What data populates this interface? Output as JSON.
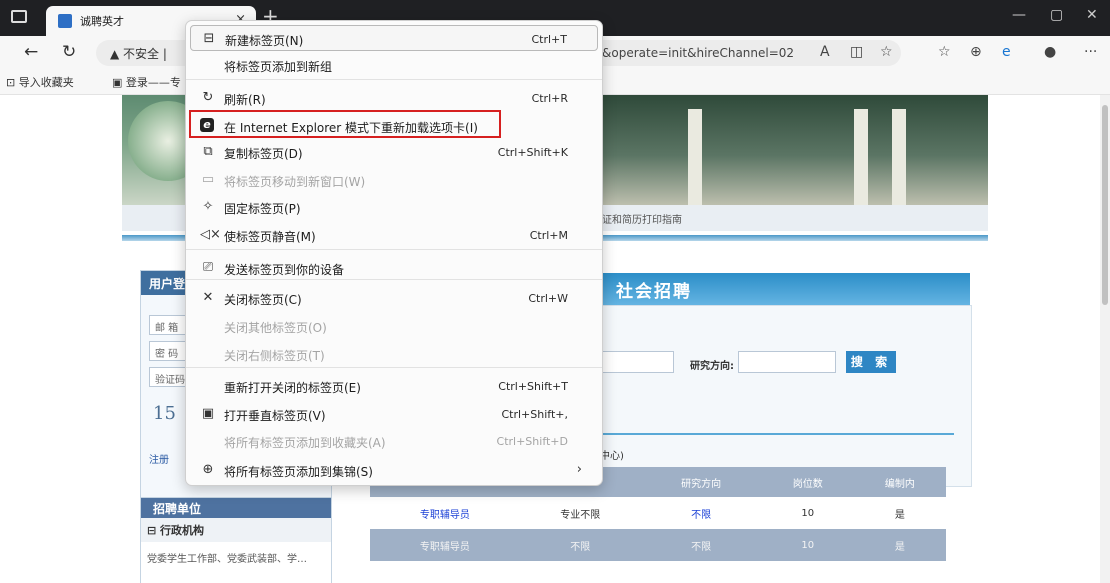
{
  "browser": {
    "tab_title": "诚聘英才",
    "tab_close": "×",
    "new_tab": "+",
    "url_security": "▲ 不安全 |",
    "url_tail": "&operate=init&hireChannel=02",
    "favbar": {
      "import_label": "导入收藏夹",
      "login_label": "登录——专"
    },
    "window": {
      "minimize": "—",
      "maximize": "▢",
      "close": "✕"
    }
  },
  "context_menu": {
    "items": [
      {
        "label": "新建标签页(N)",
        "shortcut": "Ctrl+T",
        "icon": "new-tab-icon",
        "glyph": "⊟",
        "disabled": false
      },
      {
        "label": "将标签页添加到新组",
        "shortcut": "",
        "icon": "",
        "glyph": "",
        "disabled": false
      },
      {
        "label": "刷新(R)",
        "shortcut": "Ctrl+R",
        "icon": "refresh-icon",
        "glyph": "↻",
        "disabled": false
      },
      {
        "label": "在 Internet Explorer 模式下重新加载选项卡(I)",
        "shortcut": "",
        "icon": "ie-icon",
        "glyph": "e",
        "disabled": false
      },
      {
        "label": "复制标签页(D)",
        "shortcut": "Ctrl+Shift+K",
        "icon": "duplicate-icon",
        "glyph": "⧉",
        "disabled": false
      },
      {
        "label": "将标签页移动到新窗口(W)",
        "shortcut": "",
        "icon": "window-icon",
        "glyph": "▭",
        "disabled": true
      },
      {
        "label": "固定标签页(P)",
        "shortcut": "",
        "icon": "pin-icon",
        "glyph": "✧",
        "disabled": false
      },
      {
        "label": "使标签页静音(M)",
        "shortcut": "Ctrl+M",
        "icon": "mute-icon",
        "glyph": "◁×",
        "disabled": false
      },
      {
        "label": "发送标签页到你的设备",
        "shortcut": "",
        "icon": "send-device-icon",
        "glyph": "⎚",
        "disabled": false
      },
      {
        "label": "关闭标签页(C)",
        "shortcut": "Ctrl+W",
        "icon": "close-icon",
        "glyph": "✕",
        "disabled": false
      },
      {
        "label": "关闭其他标签页(O)",
        "shortcut": "",
        "icon": "",
        "glyph": "",
        "disabled": true
      },
      {
        "label": "关闭右侧标签页(T)",
        "shortcut": "",
        "icon": "",
        "glyph": "",
        "disabled": true
      },
      {
        "label": "重新打开关闭的标签页(E)",
        "shortcut": "Ctrl+Shift+T",
        "icon": "",
        "glyph": "",
        "disabled": false
      },
      {
        "label": "打开垂直标签页(V)",
        "shortcut": "Ctrl+Shift+,",
        "icon": "vertical-tabs-icon",
        "glyph": "▣",
        "disabled": false
      },
      {
        "label": "将所有标签页添加到收藏夹(A)",
        "shortcut": "Ctrl+Shift+D",
        "icon": "",
        "glyph": "",
        "disabled": true
      },
      {
        "label": "将所有标签页添加到集锦(S)",
        "shortcut": "",
        "icon": "collections-icon",
        "glyph": "⊕",
        "disabled": false,
        "submenu": true
      }
    ]
  },
  "page": {
    "nav_text": "考证和简历打印指南",
    "login_header": "用户登",
    "login_fields": [
      "邮 箱",
      "密 码",
      "验证码"
    ],
    "captcha": "15",
    "register": "注册",
    "social_title": "社会招聘",
    "search_label": "研究方向:",
    "search_button": "搜 索",
    "center_label": "中心)",
    "recruit_unit": "招聘单位",
    "admin_org": "行政机构",
    "dept_line": "党委学生工作部、党委武装部、学…",
    "table": {
      "headers": [
        "",
        "",
        "研究方向",
        "岗位数",
        "编制内"
      ],
      "rows": [
        [
          "专职辅导员",
          "专业不限",
          "不限",
          "10",
          "是"
        ],
        [
          "专职辅导员",
          "不限",
          "不限",
          "10",
          "是"
        ]
      ]
    }
  }
}
